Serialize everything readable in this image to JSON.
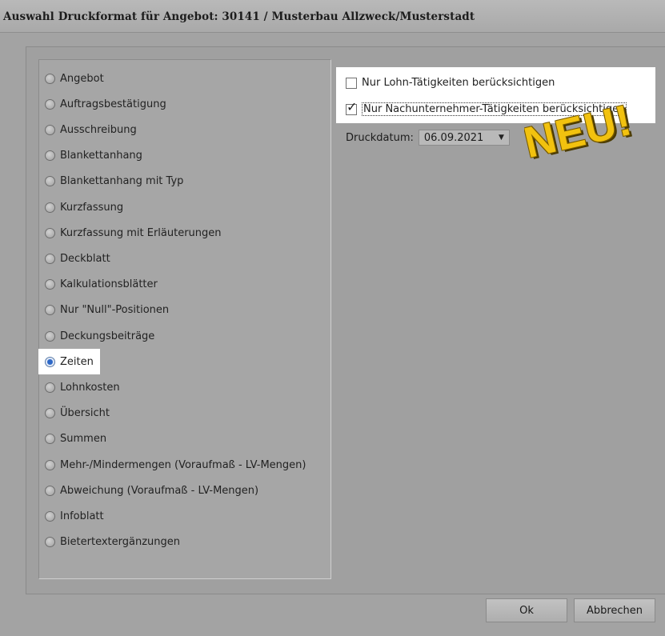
{
  "window": {
    "title": "Auswahl Druckformat für Angebot: 30141 / Musterbau Allzweck/Musterstadt"
  },
  "formats": [
    {
      "label": "Angebot",
      "selected": false
    },
    {
      "label": "Auftragsbestätigung",
      "selected": false
    },
    {
      "label": "Ausschreibung",
      "selected": false
    },
    {
      "label": "Blankettanhang",
      "selected": false
    },
    {
      "label": "Blankettanhang mit Typ",
      "selected": false
    },
    {
      "label": "Kurzfassung",
      "selected": false
    },
    {
      "label": "Kurzfassung mit Erläuterungen",
      "selected": false
    },
    {
      "label": "Deckblatt",
      "selected": false
    },
    {
      "label": "Kalkulationsblätter",
      "selected": false
    },
    {
      "label": "Nur \"Null\"-Positionen",
      "selected": false
    },
    {
      "label": "Deckungsbeiträge",
      "selected": false
    },
    {
      "label": "Zeiten",
      "selected": true
    },
    {
      "label": "Lohnkosten",
      "selected": false
    },
    {
      "label": "Übersicht",
      "selected": false
    },
    {
      "label": "Summen",
      "selected": false
    },
    {
      "label": "Mehr-/Mindermengen (Voraufmaß - LV-Mengen)",
      "selected": false
    },
    {
      "label": "Abweichung (Voraufmaß - LV-Mengen)",
      "selected": false
    },
    {
      "label": "Infoblatt",
      "selected": false
    },
    {
      "label": "Bietertextergänzungen",
      "selected": false
    }
  ],
  "options": {
    "lohn": {
      "label": "Nur Lohn-Tätigkeiten berücksichtigen",
      "checked": false
    },
    "nachunternehmer": {
      "label": "Nur Nachunternehmer-Tätigkeiten berücksichtigen",
      "checked": true
    }
  },
  "druckdatum": {
    "label": "Druckdatum:",
    "value": "06.09.2021"
  },
  "badge": {
    "text": "NEU!",
    "color": "#f2c20f"
  },
  "buttons": {
    "ok": "Ok",
    "cancel": "Abbrechen"
  }
}
